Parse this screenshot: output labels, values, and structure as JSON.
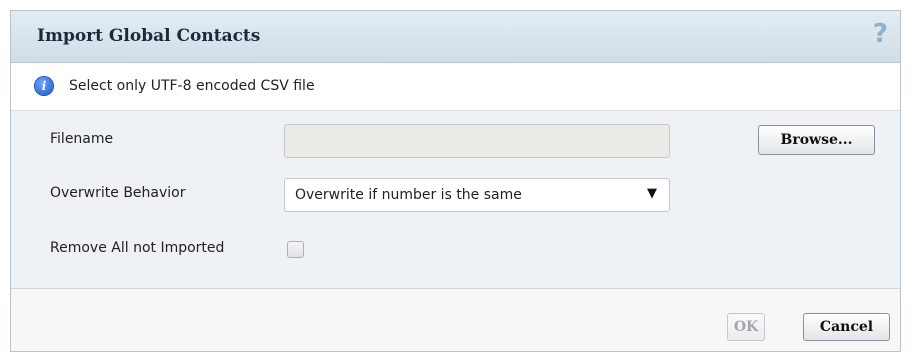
{
  "dialog": {
    "title": "Import Global Contacts",
    "help_glyph": "?",
    "help_icon": "help-question-icon",
    "info_icon": "info-icon",
    "info_glyph": "i",
    "info_text": "Select only UTF-8 encoded CSV file"
  },
  "form": {
    "filename_label": "Filename",
    "filename_value": "",
    "browse_label": "Browse...",
    "overwrite_label": "Overwrite Behavior",
    "overwrite_value": "Overwrite if number is the same",
    "caret_glyph": "▼",
    "remove_label": "Remove All not Imported",
    "remove_checked": false
  },
  "footer": {
    "ok_label": "OK",
    "ok_enabled": false,
    "cancel_label": "Cancel"
  },
  "colors": {
    "title_bar": "#d6e3ed",
    "form_bg": "#eef1f5",
    "help_icon": "#8fb0cc",
    "info_icon": "#1b52c8"
  }
}
